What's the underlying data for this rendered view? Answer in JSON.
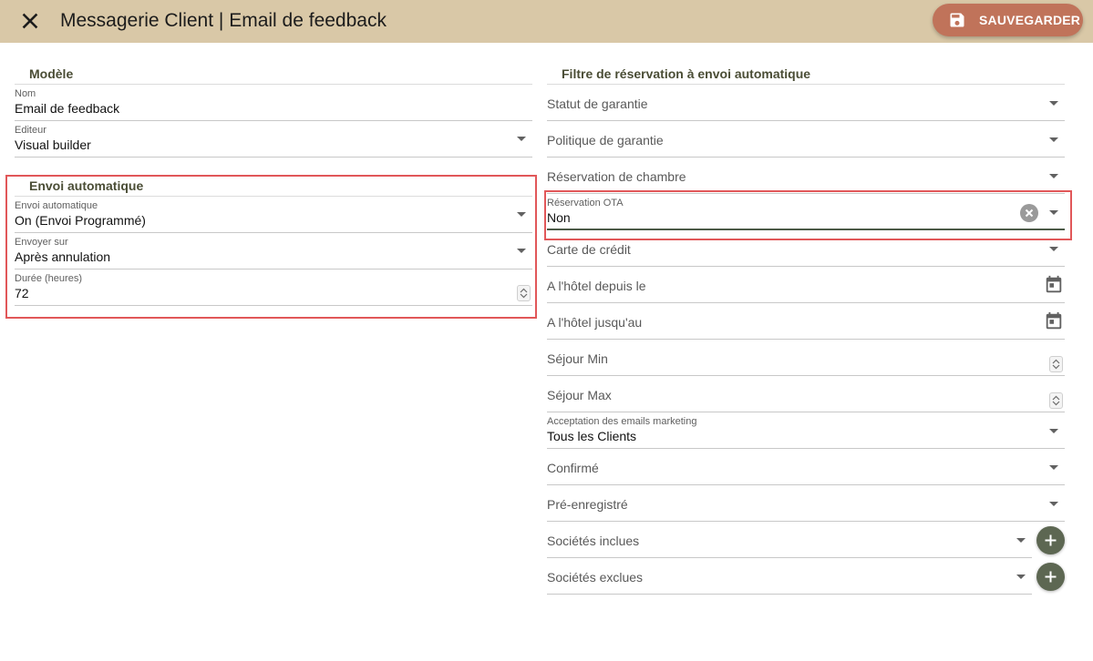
{
  "header": {
    "title": "Messagerie Client | Email de feedback",
    "save_label": "SAUVEGARDER"
  },
  "left": {
    "model": {
      "section_title": "Modèle",
      "nom": {
        "label": "Nom",
        "value": "Email de feedback"
      },
      "editeur": {
        "label": "Editeur",
        "value": "Visual builder"
      }
    },
    "auto": {
      "section_title": "Envoi automatique",
      "envoi": {
        "label": "Envoi automatique",
        "value": "On (Envoi Programmé)"
      },
      "envoyer_sur": {
        "label": "Envoyer sur",
        "value": "Après annulation"
      },
      "duree": {
        "label": "Durée (heures)",
        "value": "72"
      }
    }
  },
  "right": {
    "section_title": "Filtre de réservation à envoi automatique",
    "statut_garantie": "Statut de garantie",
    "politique_garantie": "Politique de garantie",
    "reservation_chambre": "Réservation de chambre",
    "reservation_ota": {
      "label": "Réservation OTA",
      "value": "Non"
    },
    "carte_credit": "Carte de crédit",
    "hotel_depuis": "A l'hôtel depuis le",
    "hotel_jusqu": "A l'hôtel jusqu'au",
    "sejour_min": "Séjour Min",
    "sejour_max": "Séjour Max",
    "marketing": {
      "label": "Acceptation des emails marketing",
      "value": "Tous les Clients"
    },
    "confirme": "Confirmé",
    "pre_enregistre": "Pré-enregistré",
    "societes_incluses": "Sociétés inclues",
    "societes_exclues": "Sociétés exclues"
  },
  "colors": {
    "header_bg": "#d9c8a7",
    "save_button": "#c0735a",
    "section_title": "#4a4d35",
    "add_button": "#5d6752",
    "highlight": "#e15759"
  },
  "icons": [
    "close-icon",
    "save-icon",
    "chevron-down-icon",
    "calendar-icon",
    "stepper-icon",
    "clear-icon",
    "plus-icon"
  ]
}
